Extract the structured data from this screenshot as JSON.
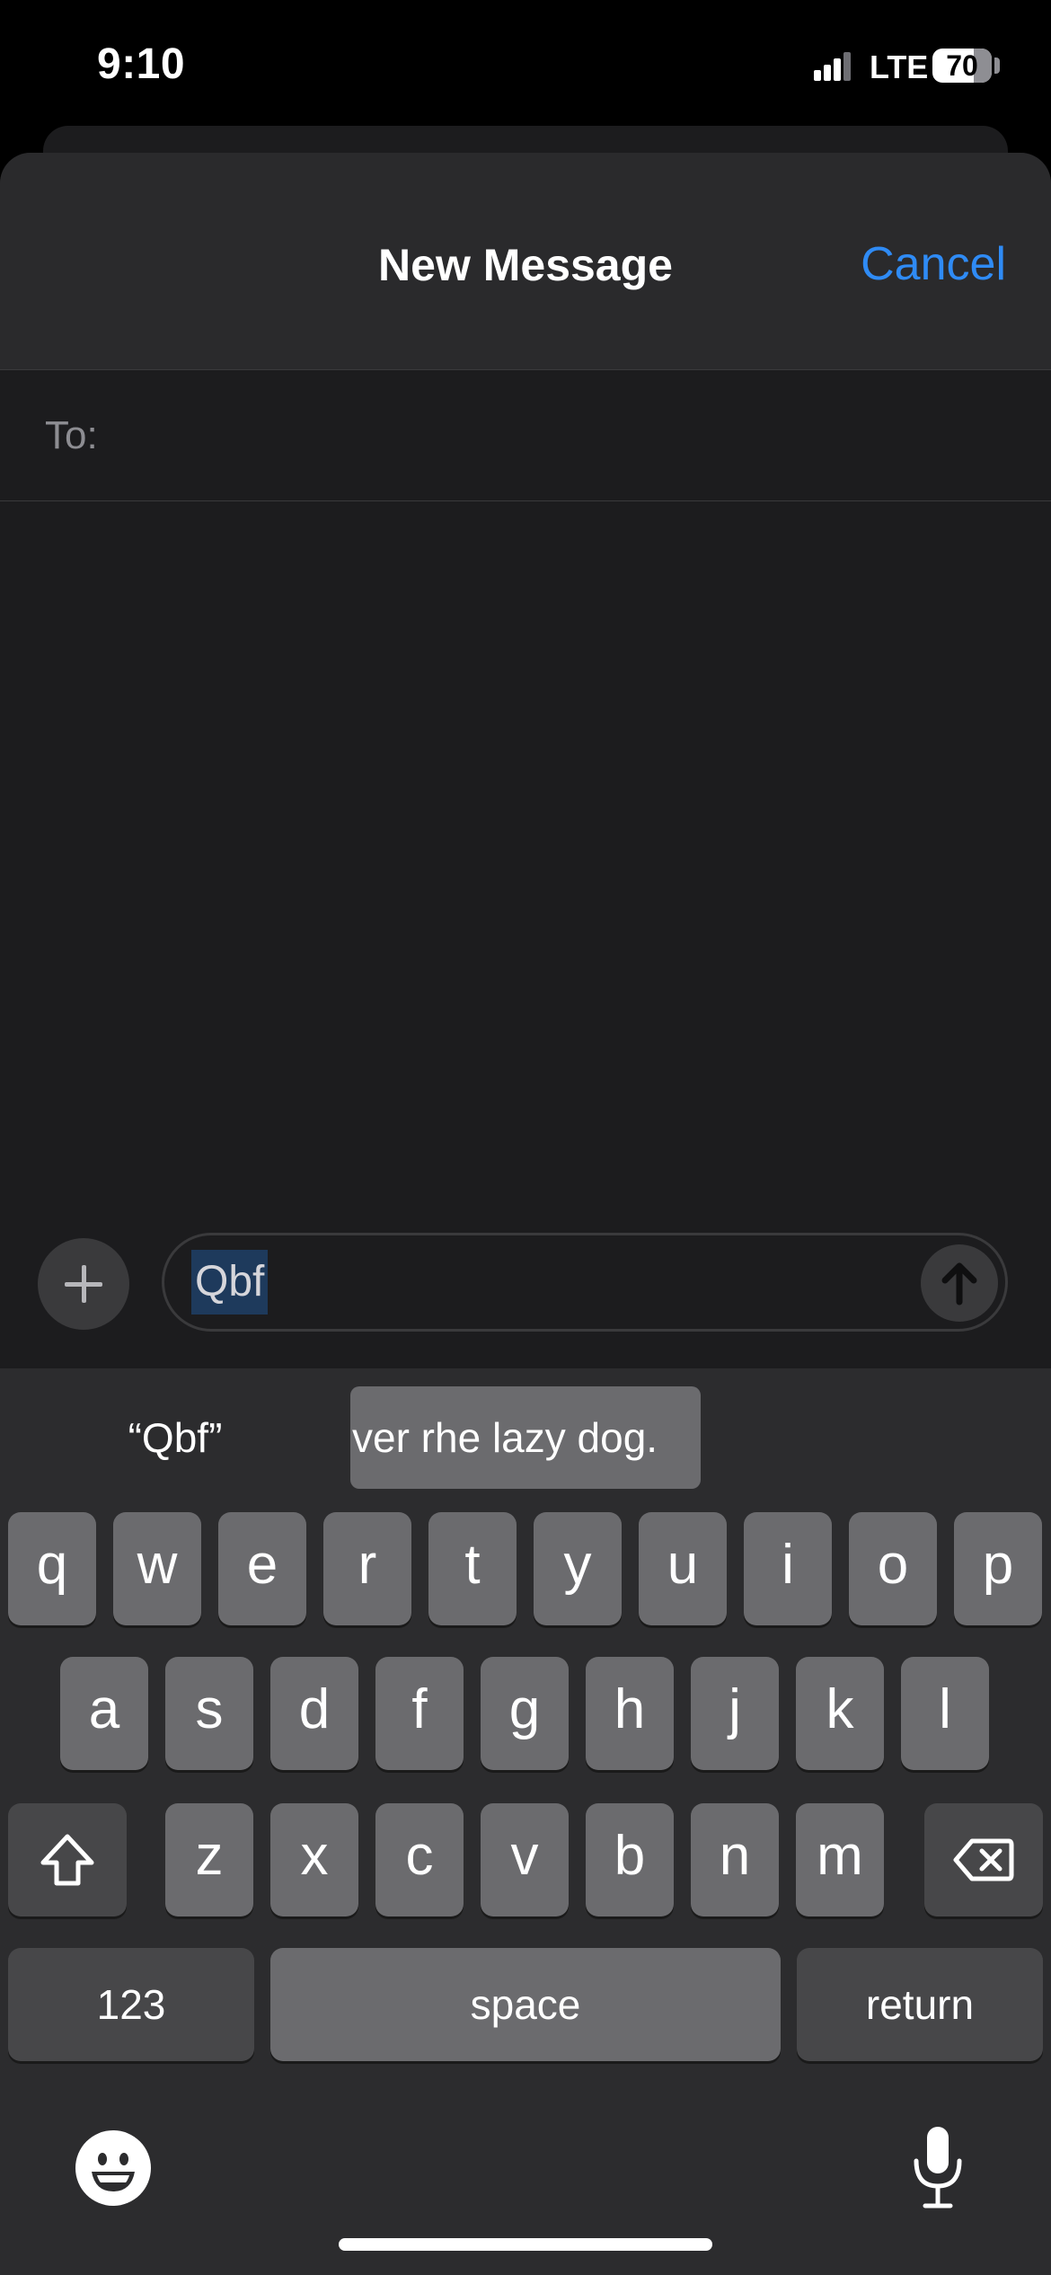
{
  "status_bar": {
    "time": "9:10",
    "network": "LTE",
    "battery": "70"
  },
  "compose": {
    "title": "New Message",
    "cancel_label": "Cancel",
    "to_label": "To:",
    "message_text": "Qbf",
    "accent_color": "#2f8bf5"
  },
  "keyboard": {
    "suggestions": [
      "“Qbf”",
      "ver rhe lazy dog."
    ],
    "row1": [
      "q",
      "w",
      "e",
      "r",
      "t",
      "y",
      "u",
      "i",
      "o",
      "p"
    ],
    "row2": [
      "a",
      "s",
      "d",
      "f",
      "g",
      "h",
      "j",
      "k",
      "l"
    ],
    "row3": [
      "z",
      "x",
      "c",
      "v",
      "b",
      "n",
      "m"
    ],
    "numbers_label": "123",
    "space_label": "space",
    "return_label": "return",
    "icons": [
      "shift-icon",
      "delete-icon",
      "emoji-icon",
      "microphone-icon"
    ]
  }
}
